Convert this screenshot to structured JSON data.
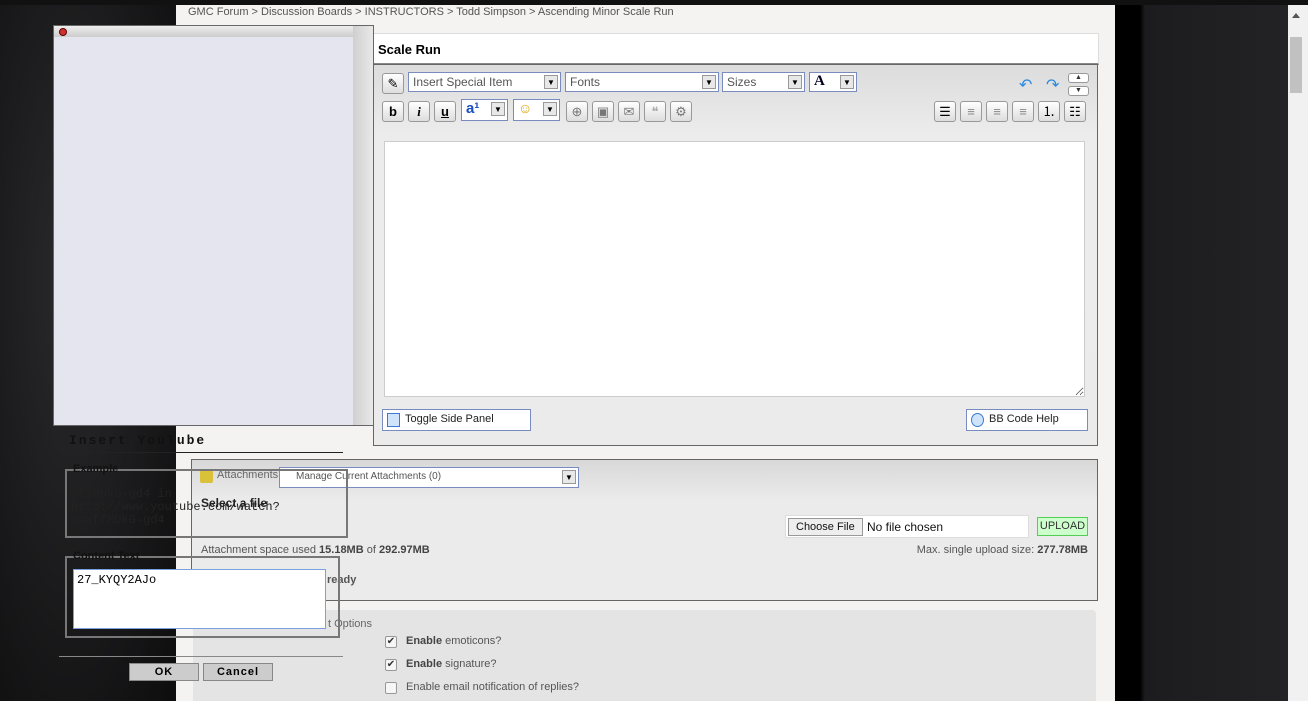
{
  "breadcrumb": "GMC Forum > Discussion Boards > INSTRUCTORS > Todd Simpson > Ascending Minor Scale Run",
  "post_title": "Scale Run",
  "toolbar": {
    "insert_special": "Insert Special Item",
    "fonts": "Fonts",
    "sizes": "Sizes",
    "font_color": "A",
    "bold": "b",
    "italic": "i",
    "underline": "u"
  },
  "editor": {
    "content": "",
    "toggle_side_panel": "Toggle Side Panel",
    "bb_code_help": "BB Code Help"
  },
  "attachments": {
    "label": "Attachments",
    "manage": "Manage Current Attachments (0)",
    "select_file": "Select a file",
    "choose_file": "Choose File",
    "no_file": "No file chosen",
    "upload": "UPLOAD",
    "space_prefix": "Attachment space used",
    "space_used": "15.18MB",
    "space_of": "of",
    "space_total": "292.97MB",
    "max_prefix": "Max. single upload size:",
    "max_size": "277.78MB",
    "status": "ready"
  },
  "options": {
    "title": "t Options",
    "items": [
      {
        "bold": "Enable",
        "rest": " emoticons?",
        "checked": true
      },
      {
        "bold": "Enable",
        "rest": " signature?",
        "checked": true
      },
      {
        "bold": "",
        "rest": "Enable email notification of replies?",
        "checked": false
      }
    ]
  },
  "youtube_dialog": {
    "title": "Insert YouTube",
    "example_legend": "Example",
    "example_text": "xffMUkG-gd4 in http://www.youtube.com/watch?v=xffMUkG-gd4",
    "content_legend": "Content Text",
    "content_value": "27_KYQY2AJo",
    "ok": "OK",
    "cancel": "Cancel"
  },
  "colors": {
    "upload_bg": "#ccffcc",
    "popup_bg": "#e5e5f0",
    "accent_border": "#7a8bc0"
  }
}
